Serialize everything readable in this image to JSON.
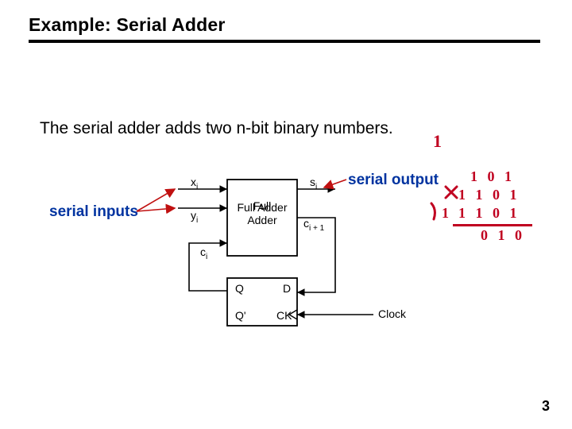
{
  "title": "Example: Serial Adder",
  "body": "The serial adder adds two n-bit binary numbers.",
  "labels": {
    "inputs": "serial inputs",
    "output": "serial output"
  },
  "block": {
    "full_adder": "Full\nAdder",
    "x": "x",
    "y": "y",
    "s": "s",
    "ci": "c",
    "ci1": "c",
    "sub_i": "i",
    "sub_i1": "i + 1",
    "Q": "Q",
    "Qb": "Q'",
    "D": "D",
    "CK": "CK",
    "Clock": "Clock"
  },
  "hand": {
    "one": "1",
    "num1": "1 0 1",
    "num2": "1 1 0 1",
    "num3": "1 1 0 1",
    "sum": "0 1 0",
    "carry": "1"
  },
  "page": "3"
}
